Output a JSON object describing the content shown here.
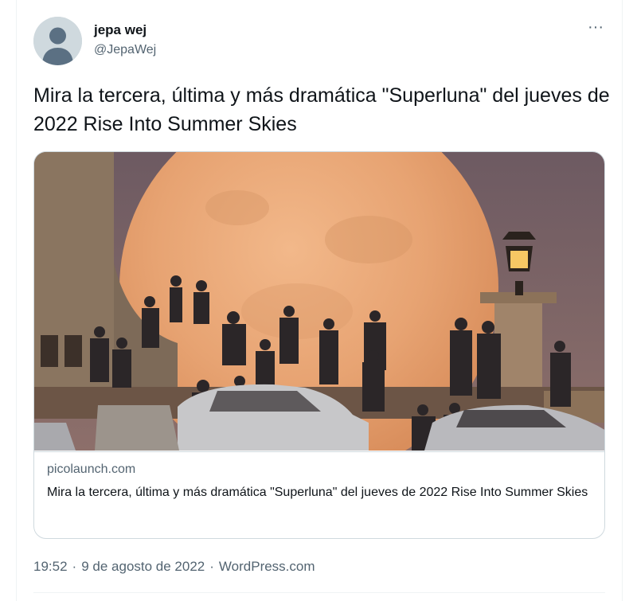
{
  "author": {
    "display_name": "jepa wej",
    "handle": "@JepaWej",
    "avatar_icon": "default-profile-icon"
  },
  "more_icon": "more-horizontal-icon",
  "more_glyph": "···",
  "tweet": {
    "text": "Mira la tercera, última y más dramática \"Superluna\" del jueves de 2022 Rise Into Summer Skies"
  },
  "link_card": {
    "domain": "picolaunch.com",
    "title": "Mira la tercera, última y más dramática \"Superluna\" del jueves de 2022 Rise Into Summer Skies"
  },
  "footer": {
    "time": "19:52",
    "separator": "·",
    "date": "9 de agosto de 2022",
    "source": "WordPress.com"
  },
  "colors": {
    "text_primary": "#0f1419",
    "text_secondary": "#536471",
    "border": "#cfd9de",
    "moon": "#e8a872"
  }
}
